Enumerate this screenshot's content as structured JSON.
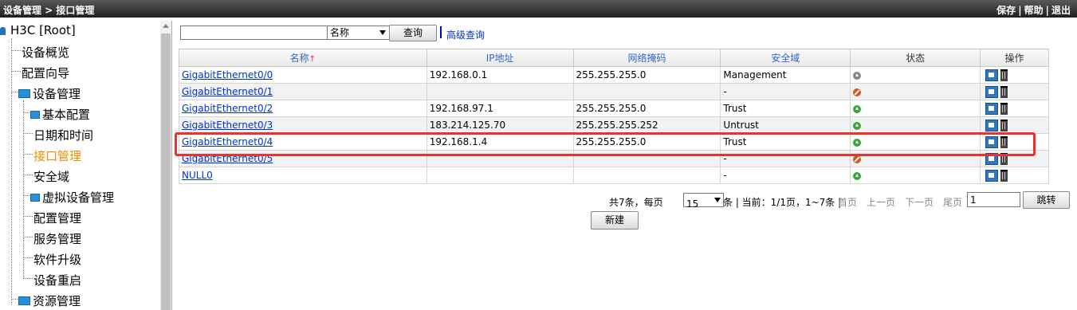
{
  "topbar": {
    "breadcrumb": "设备管理 > 接口管理",
    "links": [
      "保存",
      "帮助",
      "退出"
    ],
    "separator": "|"
  },
  "sidebar": {
    "root": "H3C [Root]",
    "items": [
      {
        "label": "设备概览",
        "level": 1,
        "folder": false
      },
      {
        "label": "配置向导",
        "level": 1,
        "folder": false
      },
      {
        "label": "设备管理",
        "level": 1,
        "folder": true
      },
      {
        "label": "基本配置",
        "level": 2,
        "folder": true
      },
      {
        "label": "日期和时间",
        "level": 2,
        "folder": false
      },
      {
        "label": "接口管理",
        "level": 2,
        "folder": false,
        "active": true
      },
      {
        "label": "安全域",
        "level": 2,
        "folder": false
      },
      {
        "label": "虚拟设备管理",
        "level": 2,
        "folder": true
      },
      {
        "label": "配置管理",
        "level": 2,
        "folder": false
      },
      {
        "label": "服务管理",
        "level": 2,
        "folder": false
      },
      {
        "label": "软件升级",
        "level": 2,
        "folder": false
      },
      {
        "label": "设备重启",
        "level": 2,
        "folder": false
      },
      {
        "label": "资源管理",
        "level": 1,
        "folder": true
      }
    ],
    "active_color": "#f28c00"
  },
  "search": {
    "input_value": "",
    "field_selected": "名称",
    "query_button": "查询",
    "advanced_link": "高级查询"
  },
  "table": {
    "headers": [
      "名称",
      "IP地址",
      "网络掩码",
      "安全域",
      "状态",
      "操作"
    ],
    "rows": [
      {
        "name": "GigabitEthernet0/0",
        "ip": "192.168.0.1",
        "mask": "255.255.255.0",
        "zone": "Management",
        "status": "gray"
      },
      {
        "name": "GigabitEthernet0/1",
        "ip": "",
        "mask": "",
        "zone": "-",
        "status": "red"
      },
      {
        "name": "GigabitEthernet0/2",
        "ip": "192.168.97.1",
        "mask": "255.255.255.0",
        "zone": "Trust",
        "status": "green"
      },
      {
        "name": "GigabitEthernet0/3",
        "ip": "183.214.125.70",
        "mask": "255.255.255.252",
        "zone": "Untrust",
        "status": "green"
      },
      {
        "name": "GigabitEthernet0/4",
        "ip": "192.168.1.4",
        "mask": "255.255.255.0",
        "zone": "Trust",
        "status": "green"
      },
      {
        "name": "GigabitEthernet0/5",
        "ip": "",
        "mask": "",
        "zone": "-",
        "status": "red"
      },
      {
        "name": "NULL0",
        "ip": "",
        "mask": "",
        "zone": "-",
        "status": "green"
      }
    ],
    "sort_arrow": "↑"
  },
  "pager": {
    "total": "共7条，每页",
    "per_page": "15",
    "suffix": "条 | 当前：1/1页，1~7条 |",
    "first": "首页",
    "prev": "上一页",
    "next": "下一页",
    "last": "尾页",
    "page_input": "1",
    "go": "跳转"
  },
  "new_button": "新建",
  "colors": {
    "link": "#0033cc",
    "highlight": "#e8342c",
    "folder": "#2a8fd6"
  }
}
